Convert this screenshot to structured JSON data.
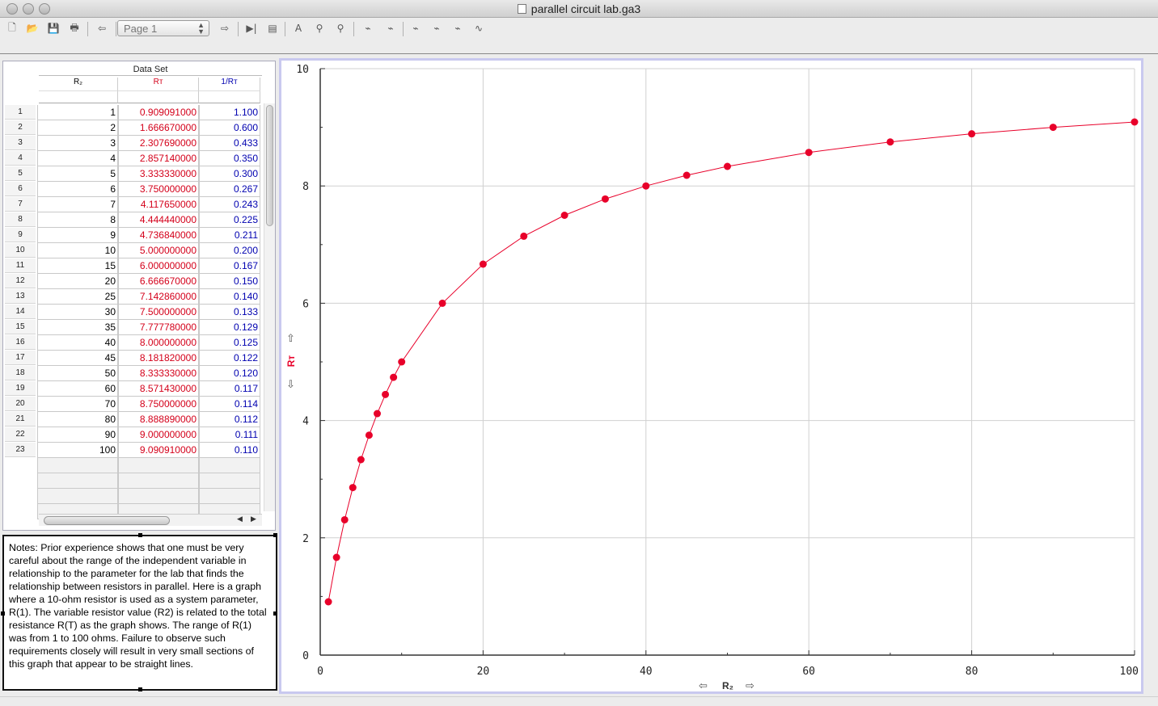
{
  "window": {
    "title": "parallel circuit lab.ga3"
  },
  "toolbar": {
    "page_select": "Page 1",
    "buttons": [
      {
        "name": "new-document-icon"
      },
      {
        "name": "open-document-icon"
      },
      {
        "name": "save-icon"
      },
      {
        "name": "print-icon"
      },
      {
        "name": "previous-page-icon"
      },
      {
        "name": "next-page-icon"
      },
      {
        "name": "start-collection-icon"
      },
      {
        "name": "stop-collection-icon"
      },
      {
        "name": "autoscale-icon"
      },
      {
        "name": "zoom-in-icon"
      },
      {
        "name": "zoom-out-icon"
      },
      {
        "name": "examine-icon"
      },
      {
        "name": "tangent-icon"
      },
      {
        "name": "statistics-icon"
      },
      {
        "name": "integral-icon"
      },
      {
        "name": "linear-fit-icon"
      },
      {
        "name": "curve-fit-icon"
      }
    ]
  },
  "table": {
    "group_title": "Data Set",
    "columns": [
      "R₂",
      "Rᴛ",
      "1/Rᴛ"
    ],
    "rows": [
      [
        "1",
        "1",
        "0.909091000",
        "1.100"
      ],
      [
        "2",
        "2",
        "1.666670000",
        "0.600"
      ],
      [
        "3",
        "3",
        "2.307690000",
        "0.433"
      ],
      [
        "4",
        "4",
        "2.857140000",
        "0.350"
      ],
      [
        "5",
        "5",
        "3.333330000",
        "0.300"
      ],
      [
        "6",
        "6",
        "3.750000000",
        "0.267"
      ],
      [
        "7",
        "7",
        "4.117650000",
        "0.243"
      ],
      [
        "8",
        "8",
        "4.444440000",
        "0.225"
      ],
      [
        "9",
        "9",
        "4.736840000",
        "0.211"
      ],
      [
        "10",
        "10",
        "5.000000000",
        "0.200"
      ],
      [
        "11",
        "15",
        "6.000000000",
        "0.167"
      ],
      [
        "12",
        "20",
        "6.666670000",
        "0.150"
      ],
      [
        "13",
        "25",
        "7.142860000",
        "0.140"
      ],
      [
        "14",
        "30",
        "7.500000000",
        "0.133"
      ],
      [
        "15",
        "35",
        "7.777780000",
        "0.129"
      ],
      [
        "16",
        "40",
        "8.000000000",
        "0.125"
      ],
      [
        "17",
        "45",
        "8.181820000",
        "0.122"
      ],
      [
        "18",
        "50",
        "8.333330000",
        "0.120"
      ],
      [
        "19",
        "60",
        "8.571430000",
        "0.117"
      ],
      [
        "20",
        "70",
        "8.750000000",
        "0.114"
      ],
      [
        "21",
        "80",
        "8.888890000",
        "0.112"
      ],
      [
        "22",
        "90",
        "9.000000000",
        "0.111"
      ],
      [
        "23",
        "100",
        "9.090910000",
        "0.110"
      ]
    ]
  },
  "notes": "Notes: Prior experience shows that one must be very careful about the range of the independent variable in relationship to the parameter for the lab that finds the relationship between resistors in parallel. Here is a graph where a 10-ohm resistor is used as a system parameter, R(1). The variable resistor value (R2) is related to the total resistance R(T) as the graph shows. The range of R(1) was from 1 to 100 ohms. Failure to observe such requirements closely will result in very small sections of this graph that appear to be straight lines.",
  "colors": {
    "series": "#e8002a",
    "accent_blue": "#0000b0",
    "panel_border": "#c9c9ef"
  },
  "chart_data": {
    "type": "line",
    "xlabel": "R₂",
    "ylabel": "Rᴛ",
    "xlim": [
      0,
      100
    ],
    "ylim": [
      0,
      10
    ],
    "xticks": [
      "0",
      "20",
      "40",
      "60",
      "80",
      "100"
    ],
    "yticks": [
      "0",
      "2",
      "4",
      "6",
      "8",
      "10"
    ],
    "grid": true,
    "markers": true,
    "x": [
      1,
      2,
      3,
      4,
      5,
      6,
      7,
      8,
      9,
      10,
      15,
      20,
      25,
      30,
      35,
      40,
      45,
      50,
      60,
      70,
      80,
      90,
      100
    ],
    "y": [
      0.909091,
      1.66667,
      2.30769,
      2.85714,
      3.33333,
      3.75,
      4.11765,
      4.44444,
      4.73684,
      5.0,
      6.0,
      6.66667,
      7.14286,
      7.5,
      7.77778,
      8.0,
      8.18182,
      8.33333,
      8.57143,
      8.75,
      8.88889,
      9.0,
      9.09091
    ]
  }
}
